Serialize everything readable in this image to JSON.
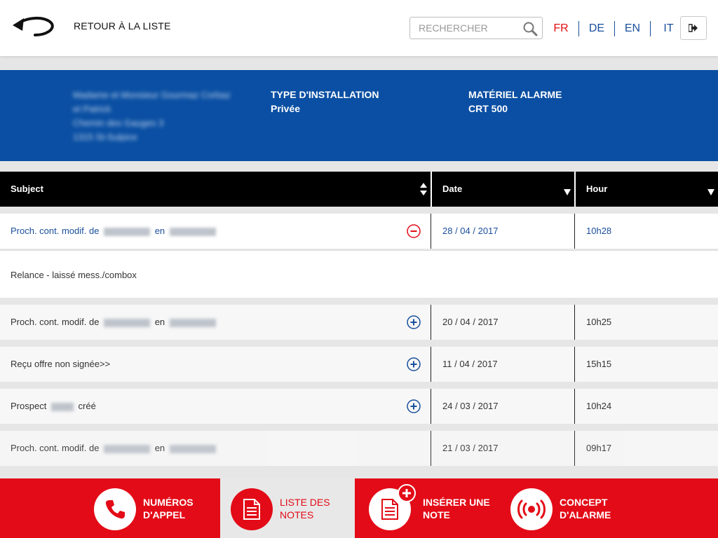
{
  "header": {
    "back_label": "RETOUR À LA LISTE",
    "search_placeholder": "RECHERCHER",
    "languages": [
      "FR",
      "DE",
      "EN",
      "IT"
    ],
    "active_language": "FR"
  },
  "info": {
    "client_lines": [
      "Madame et Monsieur Gourmaz Corbaz",
      "et Patrick",
      "Chemin des Gauges 3",
      "1315 St-Sulpice"
    ],
    "installation_label": "TYPE D'INSTALLATION",
    "installation_value": "Privée",
    "alarm_label": "MATÉRIEL ALARME",
    "alarm_value": "CRT 500"
  },
  "table": {
    "columns": [
      "Subject",
      "Date",
      "Hour"
    ],
    "rows": [
      {
        "subject_prefix": "Proch. cont. modif. de",
        "subject_mid": "en",
        "subject_suffix": "",
        "date": "28 / 04 / 2017",
        "hour": "10h28",
        "expanded": true
      },
      {
        "subject_prefix": "Proch. cont. modif. de",
        "subject_mid": "en",
        "subject_suffix": "",
        "date": "20 / 04 / 2017",
        "hour": "10h25",
        "expanded": false
      },
      {
        "subject_prefix": "Reçu offre non signée>>",
        "subject_mid": "",
        "subject_suffix": "",
        "date": "11 / 04 / 2017",
        "hour": "15h15",
        "expanded": false
      },
      {
        "subject_prefix": "Prospect",
        "subject_mid": "",
        "subject_suffix": "créé",
        "date": "24 / 03 / 2017",
        "hour": "10h24",
        "expanded": false
      },
      {
        "subject_prefix": "Proch. cont. modif. de",
        "subject_mid": "en",
        "subject_suffix": "",
        "date": "21 / 03 / 2017",
        "hour": "09h17",
        "expanded": false
      }
    ],
    "expanded_note": "Relance - laissé mess./combox"
  },
  "bottom_nav": [
    {
      "line1": "NUMÉROS",
      "line2": "D'APPEL",
      "icon": "phone-icon"
    },
    {
      "line1": "LISTE DES",
      "line2": "NOTES",
      "icon": "document-icon",
      "active": true
    },
    {
      "line1": "INSÉRER UNE",
      "line2": "NOTE",
      "icon": "add-document-icon"
    },
    {
      "line1": "CONCEPT",
      "line2": "D'ALARME",
      "icon": "alarm-icon"
    }
  ],
  "colors": {
    "brand_blue": "#0a4fa3",
    "brand_red": "#e30b17",
    "link_blue": "#1a4f9c"
  }
}
